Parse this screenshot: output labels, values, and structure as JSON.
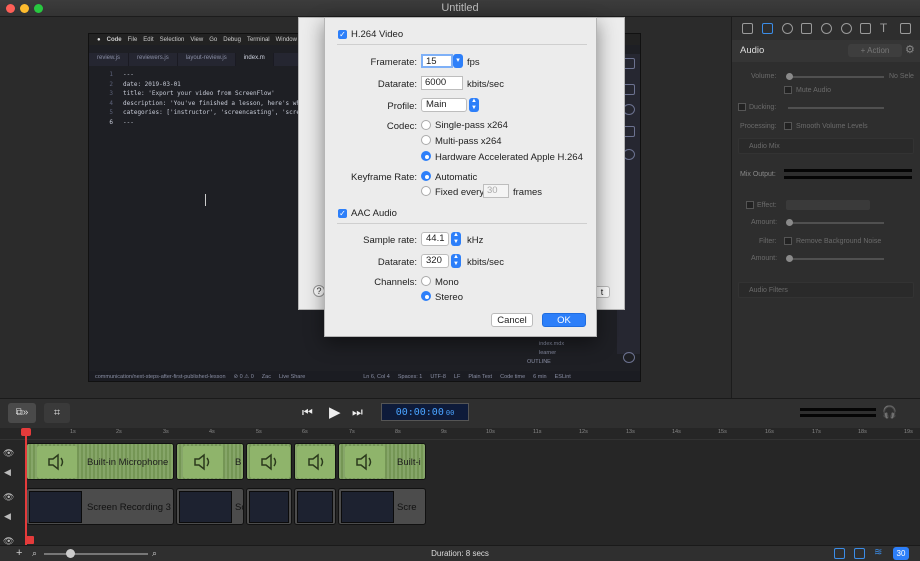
{
  "window": {
    "title": "Untitled"
  },
  "recording": {
    "menu": [
      "Code",
      "File",
      "Edit",
      "Selection",
      "View",
      "Go",
      "Debug",
      "Terminal",
      "Window"
    ],
    "tabs": [
      "review.js",
      "reviewers.js",
      "layout-review.js",
      "index.m"
    ],
    "code_lines": [
      {
        "n": "1",
        "t": "---"
      },
      {
        "n": "2",
        "t": "date: 2019-03-01"
      },
      {
        "n": "3",
        "t": "title: 'Export your video from ScreenFlow'"
      },
      {
        "n": "4",
        "t": "description: 'You've finished a lesson, here's what"
      },
      {
        "n": "5",
        "t": "categories: ['instructor', 'screencasting', 'scre"
      },
      {
        "n": "6",
        "t": "---"
      }
    ],
    "explorer_items": [
      "index.mdx",
      "learner",
      "OUTLINE"
    ],
    "status_items": [
      "communication/next-steps-after-first-published-lesson",
      "⊘ 0 ⚠ 0",
      "Zac",
      "Live Share",
      "Ln 6, Col 4",
      "Spaces: 1",
      "UTF-8",
      "LF",
      "Plain Text",
      "Code time",
      "6 min",
      "ESLint"
    ]
  },
  "back_dialog": {
    "help": "?",
    "button_fragment": "t"
  },
  "dialog": {
    "video_section": "H.264 Video",
    "framerate_label": "Framerate:",
    "framerate_value": "15",
    "framerate_unit": "fps",
    "datarate_label": "Datarate:",
    "datarate_value": "6000",
    "datarate_unit": "kbits/sec",
    "profile_label": "Profile:",
    "profile_value": "Main",
    "codec_label": "Codec:",
    "codec_options": [
      "Single-pass x264",
      "Multi-pass x264",
      "Hardware Accelerated Apple H.264"
    ],
    "codec_selected": 2,
    "keyframe_label": "Keyframe Rate:",
    "keyframe_auto": "Automatic",
    "keyframe_fixed": "Fixed every",
    "keyframe_fixed_placeholder": "30",
    "keyframe_unit": "frames",
    "audio_section": "AAC Audio",
    "samplerate_label": "Sample rate:",
    "samplerate_value": "44.1",
    "samplerate_unit": "kHz",
    "audio_datarate_label": "Datarate:",
    "audio_datarate_value": "320",
    "audio_datarate_unit": "kbits/sec",
    "channels_label": "Channels:",
    "channels_mono": "Mono",
    "channels_stereo": "Stereo",
    "cancel_label": "Cancel",
    "ok_label": "OK",
    "accent": "#2d7ff9"
  },
  "inspector": {
    "section": "Audio",
    "action_label": "+ Action",
    "volume_label": "Volume:",
    "no_sel": "No Sele",
    "mute_audio": "Mute Audio",
    "ducking": "Ducking:",
    "processing": "Processing:",
    "smooth_volume": "Smooth Volume Levels",
    "audio_mix": "Audio Mix",
    "mix_output": "Mix Output:",
    "effect": "Effect:",
    "amount": "Amount:",
    "filter": "Filter:",
    "remove_noise": "Remove Background Noise",
    "amount2": "Amount:",
    "audio_filters": "Audio Filters"
  },
  "transport": {
    "timecode_main": "00:00:00",
    "timecode_frames": "00"
  },
  "timeline": {
    "ruler": [
      "1s",
      "2s",
      "3s",
      "4s",
      "5s",
      "6s",
      "7s",
      "8s",
      "9s",
      "10s",
      "11s",
      "12s",
      "13s",
      "14s",
      "15s",
      "16s",
      "17s",
      "18s",
      "19s"
    ],
    "audio_clip_labels": [
      "Built-in Microphone",
      "B",
      "Built-i"
    ],
    "video_clip_labels": [
      "Screen Recording 3",
      "Sc",
      "Scre"
    ],
    "playhead_colour": "#e43b3b",
    "badge": "30"
  },
  "footer": {
    "duration": "Duration: 8 secs"
  }
}
